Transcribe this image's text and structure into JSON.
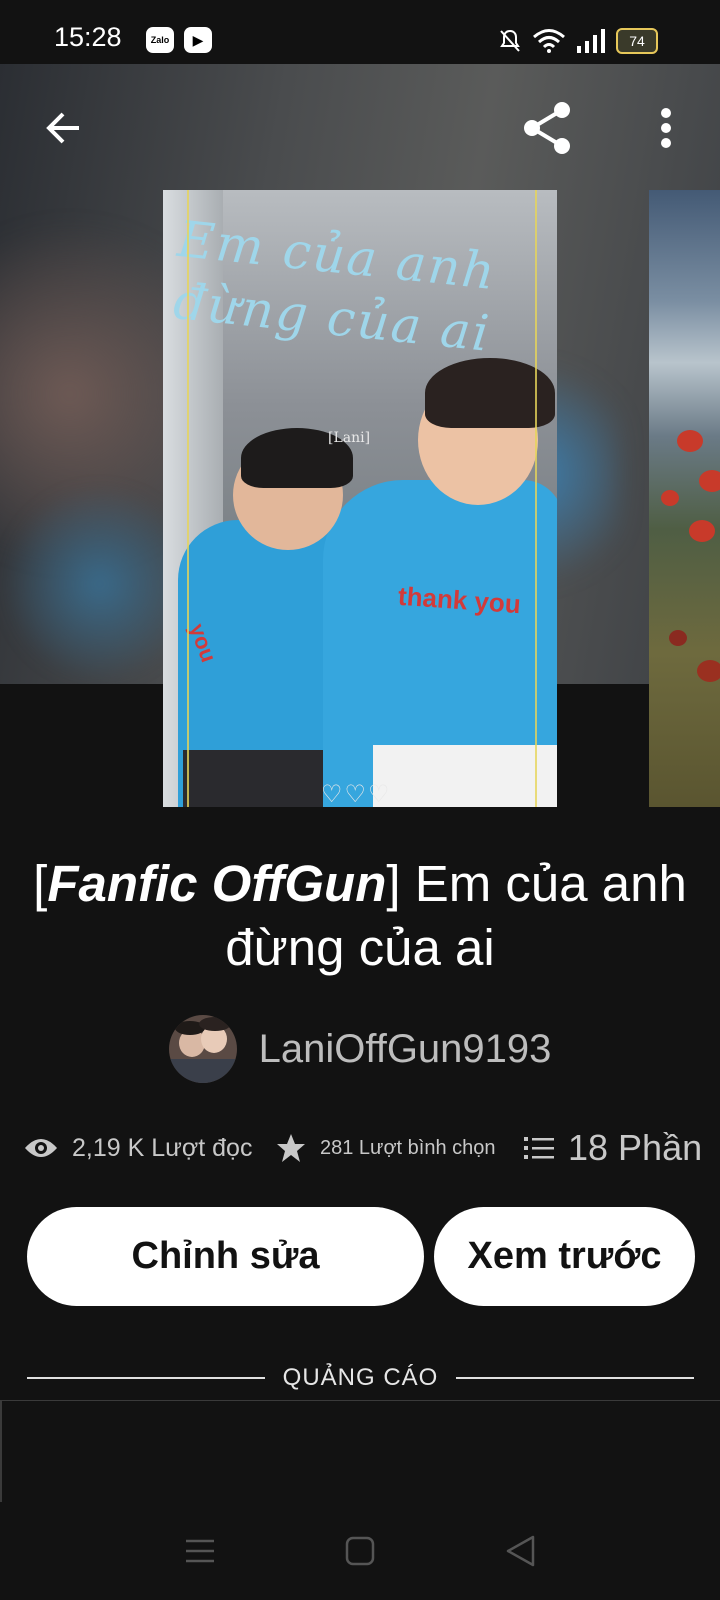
{
  "status_bar": {
    "time": "15:28",
    "app_badges": [
      "Zalo",
      "▶"
    ],
    "battery": "74",
    "icons": [
      "bell-off-icon",
      "wifi-icon",
      "signal-icon",
      "battery-icon"
    ]
  },
  "top_bar": {
    "icons": [
      "back-arrow-icon",
      "share-icon",
      "more-vert-icon"
    ]
  },
  "cover": {
    "title_line1": "Em của anh",
    "title_line2": "đừng của ai",
    "tag": "[Lani]",
    "shirt_print": "thank you",
    "shirt_print2": "you",
    "hearts": "♡♡♡"
  },
  "story": {
    "title_prefix_open": "[",
    "title_bold": "Fanfic OffGun",
    "title_prefix_close": "]",
    "title_rest": " Em của anh đừng của ai",
    "author": "LaniOffGun9193"
  },
  "stats": {
    "reads": "2,19 K Lượt đọc",
    "votes": "281 Lượt bình chọn",
    "parts": "18 Phần"
  },
  "actions": {
    "edit": "Chỉnh sửa",
    "preview": "Xem trước"
  },
  "ad": {
    "label": "QUẢNG CÁO"
  },
  "nav": {
    "icons": [
      "menu-icon",
      "home-square-icon",
      "back-triangle-icon"
    ]
  },
  "colors": {
    "background": "#121212",
    "button_bg": "#ffffff",
    "accent_blue": "#36a6de"
  }
}
